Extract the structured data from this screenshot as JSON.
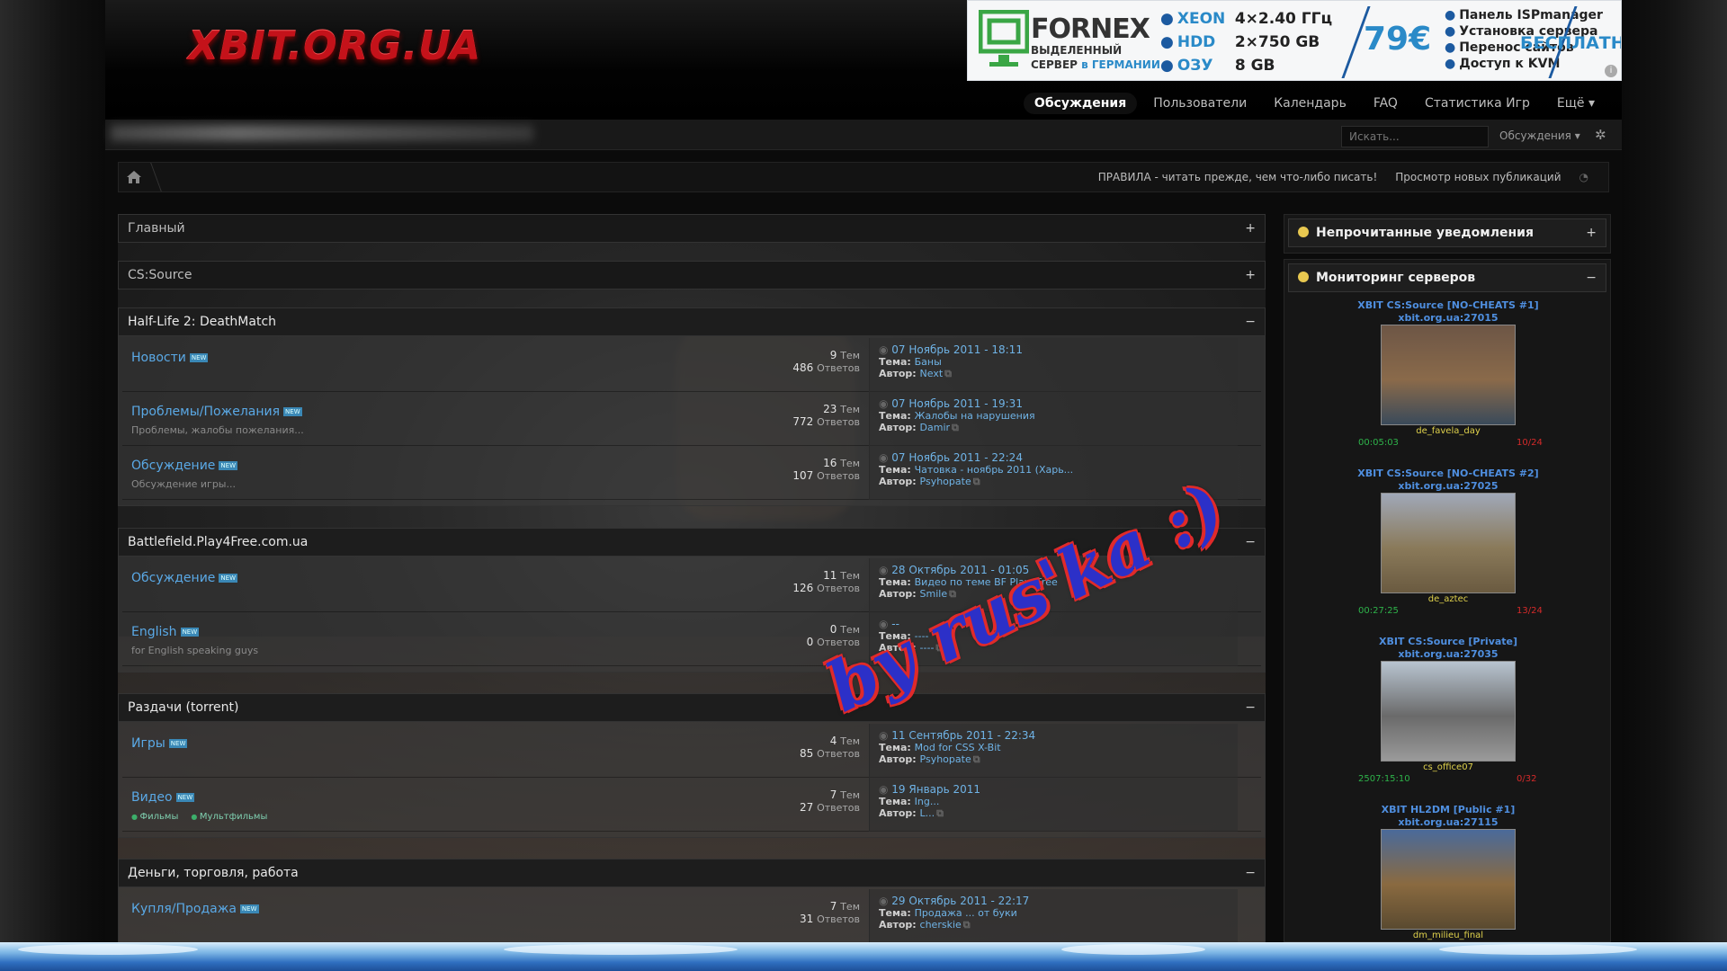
{
  "site": {
    "logo": "XBIT.ORG.UA"
  },
  "ad": {
    "brand": "FORNEX",
    "sub1": "ВЫДЕЛЕННЫЙ",
    "sub2_prefix": "СЕРВЕР",
    "sub2_suffix": "в ГЕРМАНИИ",
    "specs": [
      {
        "key": "XEON",
        "value": "4×2.40 ГГц"
      },
      {
        "key": "HDD",
        "value": "2×750 GB"
      },
      {
        "key": "ОЗУ",
        "value": "8 GB"
      }
    ],
    "price": "79€",
    "features": [
      "Панель ISPmanager",
      "Установка сервера",
      "Перенос сайтов",
      "Доступ к KVM"
    ],
    "free": "БЕСПЛАТНО",
    "info": "i"
  },
  "nav": {
    "items": [
      "Обсуждения",
      "Пользователи",
      "Календарь",
      "FAQ",
      "Статистика Игр",
      "Ещё ▾"
    ]
  },
  "search": {
    "placeholder": "Искать...",
    "scope": "Обсуждения ▾",
    "gear": "✲"
  },
  "breadcrumb": {
    "links": [
      "ПРАВИЛА - читать прежде, чем что-либо писать!",
      "Просмотр новых публикаций"
    ],
    "rss": "◔"
  },
  "labels": {
    "topics": "Тем",
    "replies": "Ответов",
    "topic": "Тема:",
    "author": "Автор:",
    "new": "NEW",
    "ext": "⧉"
  },
  "categories": [
    {
      "title": "Главный",
      "toggle": "+",
      "collapsed": true
    },
    {
      "title": "CS:Source",
      "toggle": "+",
      "collapsed": true
    },
    {
      "title": "Half-Life 2: DeathMatch",
      "toggle": "−",
      "collapsed": false,
      "forums": [
        {
          "name": "Новости",
          "desc": "",
          "topics": "9",
          "replies": "486",
          "date": "07 Ноябрь 2011 - 18:11",
          "topic": "Баны",
          "author": "Next"
        },
        {
          "name": "Проблемы/Пожелания",
          "desc": "Проблемы, жалобы пожелания...",
          "topics": "23",
          "replies": "772",
          "date": "07 Ноябрь 2011 - 19:31",
          "topic": "Жалобы на нарушения",
          "author": "Damir"
        },
        {
          "name": "Обсуждение",
          "desc": "Обсуждение игры...",
          "topics": "16",
          "replies": "107",
          "date": "07 Ноябрь 2011 - 22:24",
          "topic": "Чатовка - ноябрь 2011 (Харь...",
          "author": "Psyhopate"
        }
      ]
    },
    {
      "title": "Battlefield.Play4Free.com.ua",
      "toggle": "−",
      "collapsed": false,
      "forums": [
        {
          "name": "Обсуждение",
          "desc": "",
          "topics": "11",
          "replies": "126",
          "date": "28 Октябрь 2011 - 01:05",
          "topic": "Видео по теме BF Play4Free",
          "author": "Smile"
        },
        {
          "name": "English",
          "desc": "for English speaking guys",
          "topics": "0",
          "replies": "0",
          "date": "--",
          "topic": "----",
          "author": "----"
        }
      ]
    },
    {
      "title": "Раздачи (torrent)",
      "toggle": "−",
      "collapsed": false,
      "forums": [
        {
          "name": "Игры",
          "desc": "",
          "topics": "4",
          "replies": "85",
          "date": "11 Сентябрь 2011 - 22:34",
          "topic": "Mod for CSS X-Bit",
          "author": "Psyhopate"
        },
        {
          "name": "Видео",
          "desc": "",
          "subs": [
            "Фильмы",
            "Мультфильмы"
          ],
          "topics": "7",
          "replies": "27",
          "date": "19 Январь 2011",
          "topic": "Ing...",
          "author": "L..."
        }
      ]
    },
    {
      "title": "Деньги, торговля, работа",
      "toggle": "−",
      "collapsed": false,
      "forums": [
        {
          "name": "Купля/Продажа",
          "desc": "",
          "topics": "7",
          "replies": "31",
          "date": "29 Октябрь 2011 - 22:17",
          "topic": "Продажа ... от буки",
          "author": "cherskie"
        }
      ]
    }
  ],
  "sidebar": {
    "notifications": {
      "title": "Непрочитанные уведомления",
      "toggle": "+"
    },
    "monitoring": {
      "title": "Мониторинг серверов",
      "toggle": "−"
    },
    "servers": [
      {
        "name": "XBIT CS:Source [NO-CHEATS #1]",
        "addr": "xbit.org.ua:27015",
        "map": "de_favela_day",
        "time": "00:05:03",
        "players": "10/24",
        "thumb_colors": [
          "#6d5646",
          "#8a6a4a",
          "#3a4a5a"
        ]
      },
      {
        "name": "XBIT CS:Source [NO-CHEATS #2]",
        "addr": "xbit.org.ua:27025",
        "map": "de_aztec",
        "time": "00:27:25",
        "players": "13/24",
        "thumb_colors": [
          "#a0a8b8",
          "#8a7a5a",
          "#6a5a40"
        ]
      },
      {
        "name": "XBIT CS:Source [Private]",
        "addr": "xbit.org.ua:27035",
        "map": "cs_office07",
        "time": "2507:15:10",
        "players": "0/32",
        "thumb_colors": [
          "#b8c4d0",
          "#6a6a6a",
          "#9a9a9a"
        ]
      },
      {
        "name": "XBIT HL2DM [Public #1]",
        "addr": "xbit.org.ua:27115",
        "map": "dm_milieu_final",
        "time": "",
        "players": "",
        "thumb_colors": [
          "#4a6a9a",
          "#8a6a40",
          "#5a4a30"
        ]
      }
    ]
  },
  "watermark": "by rus'ka :)",
  "colors": {
    "link": "#5aa9e6",
    "server_name": "#4f8fe0",
    "map": "#e0d24c",
    "time": "#2eb34a",
    "players": "#d42a2a",
    "logo": "#c4121a"
  }
}
